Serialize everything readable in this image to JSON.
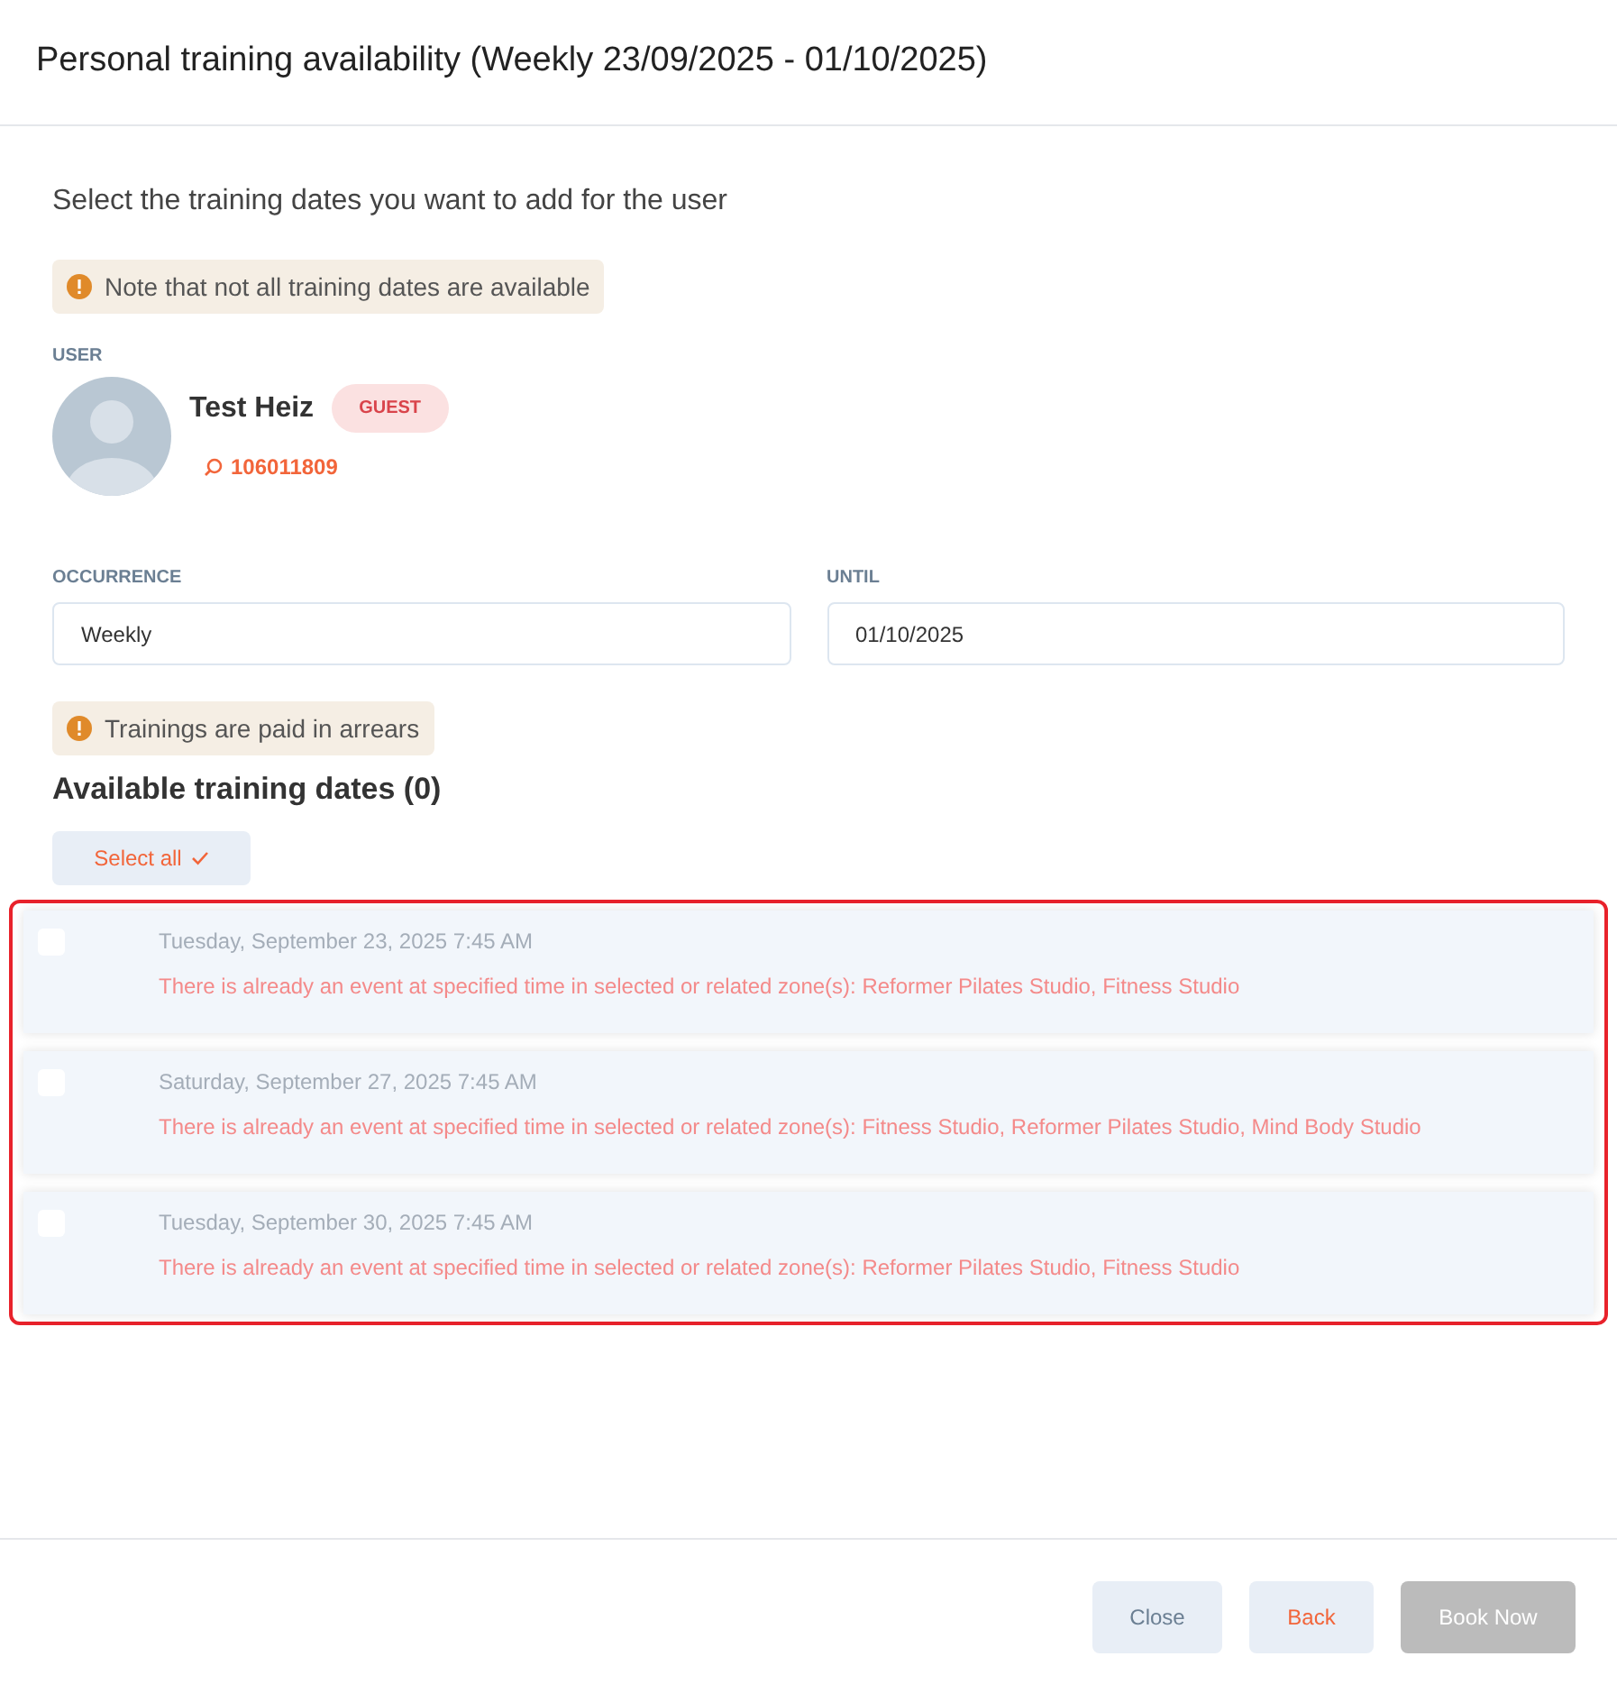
{
  "window": {
    "title": "Personal training availability (Weekly 23/09/2025 - 01/10/2025)"
  },
  "instruction": "Select the training dates you want to add for the user",
  "notice": "Note that not all training dates are available",
  "user": {
    "label": "USER",
    "name": "Test Heiz",
    "badge": "GUEST",
    "id": "106011809"
  },
  "fields": [
    {
      "label": "OCCURRENCE",
      "value": "Weekly"
    },
    {
      "label": "UNTIL",
      "value": "01/10/2025"
    }
  ],
  "payment_notice": "Trainings are paid in arrears",
  "dates": {
    "heading": "Available training dates (0)",
    "select_all": "Select all",
    "highlighted": true,
    "items": [
      {
        "date": "Tuesday, September 23, 2025 7:45 AM",
        "message": "There is already an event at specified time in selected or related zone(s): Reformer Pilates Studio, Fitness Studio",
        "checked": false,
        "disabled": true
      },
      {
        "date": "Saturday, September 27, 2025 7:45 AM",
        "message": "There is already an event at specified time in selected or related zone(s): Fitness Studio, Reformer Pilates Studio, Mind Body Studio",
        "checked": false,
        "disabled": true
      },
      {
        "date": "Tuesday, September 30, 2025 7:45 AM",
        "message": "There is already an event at specified time in selected or related zone(s): Reformer Pilates Studio, Fitness Studio",
        "checked": false,
        "disabled": true
      }
    ]
  },
  "buttons": [
    {
      "label": "Close",
      "kind": "secondary",
      "disabled": false
    },
    {
      "label": "Back",
      "kind": "accent",
      "disabled": false
    },
    {
      "label": "Book Now",
      "kind": "primary",
      "disabled": true
    }
  ]
}
